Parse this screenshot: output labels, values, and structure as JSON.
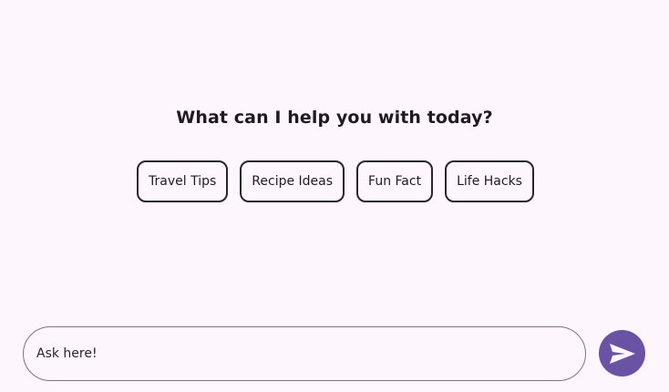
{
  "prompt": {
    "heading": "What can I help you with today?"
  },
  "suggestions": [
    {
      "label": "Travel Tips"
    },
    {
      "label": "Recipe Ideas"
    },
    {
      "label": "Fun Fact"
    },
    {
      "label": "Life Hacks"
    }
  ],
  "composer": {
    "placeholder": "Ask here!",
    "value": ""
  },
  "icons": {
    "send": "send-icon"
  },
  "colors": {
    "background": "#fdf7fd",
    "accent": "#6a52a4",
    "chip_border": "#2a2528",
    "input_border": "#7c757c"
  }
}
